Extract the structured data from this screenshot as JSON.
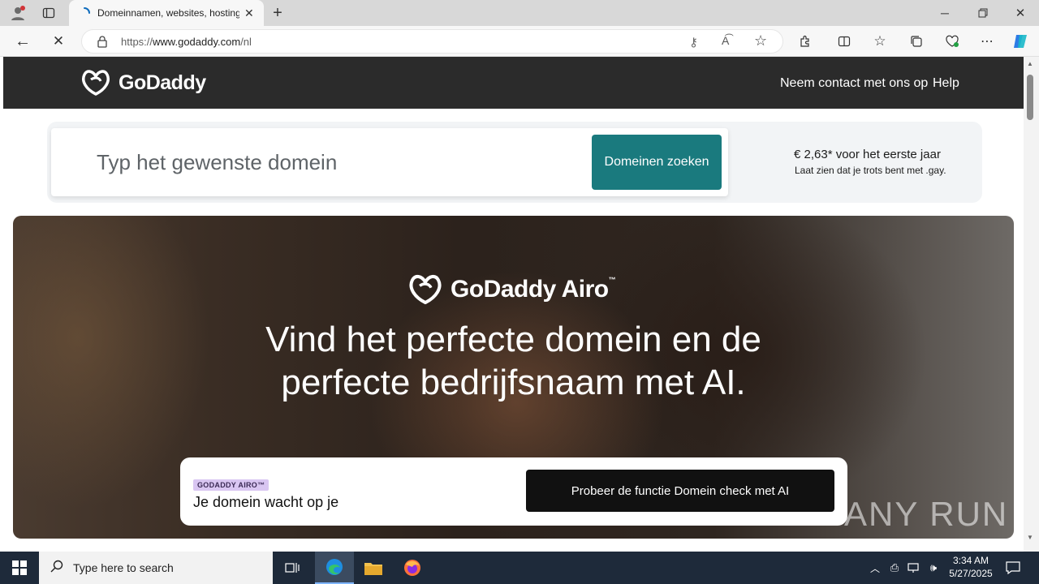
{
  "browser": {
    "tab_title": "Domeinnamen, websites, hosting",
    "url_prefix": "https://",
    "url_host": "www.godaddy.com",
    "url_path": "/nl"
  },
  "header": {
    "logo": "GoDaddy",
    "contact_link": "Neem contact met ons op",
    "help_link": "Help"
  },
  "search": {
    "placeholder": "Typ het gewenste domein",
    "button_label": "Domeinen zoeken",
    "promo_price": "€ 2,63* voor het eerste jaar",
    "promo_sub": "Laat zien dat je trots bent met .gay."
  },
  "hero": {
    "logo": "GoDaddy Airo",
    "logo_tm": "™",
    "headline_line1": "Vind het perfecte domein en de",
    "headline_line2": "perfecte bedrijfsnaam met AI.",
    "badge": "GODADDY AIRO™",
    "card_title": "Je domein wacht op je",
    "card_button": "Probeer de functie Domein check met AI"
  },
  "watermark": "ANY RUN",
  "taskbar": {
    "search_placeholder": "Type here to search",
    "time": "3:34 AM",
    "date": "5/27/2025"
  },
  "colors": {
    "teal_button": "#1a7a7e",
    "header_dark": "#2b2b2b",
    "taskbar": "#1e2a3a"
  }
}
